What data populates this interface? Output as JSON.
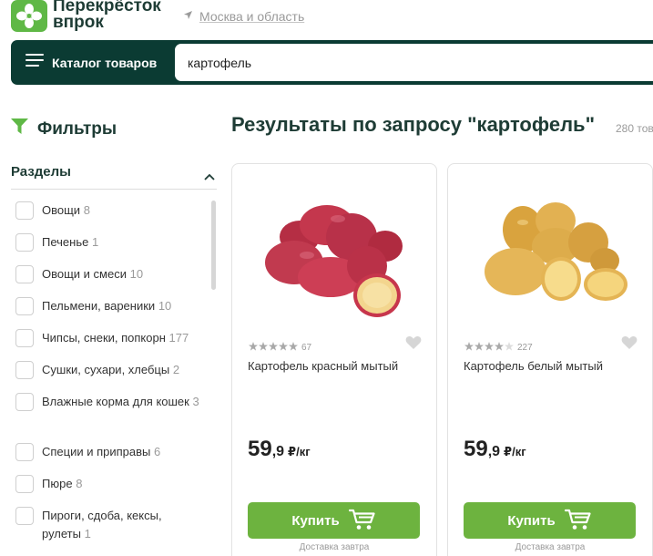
{
  "header": {
    "brand_line1": "Перекрёсток",
    "brand_line2": "впрок",
    "location": "Москва и область"
  },
  "nav": {
    "catalog_label": "Каталог товаров",
    "search_value": "картофель"
  },
  "filters": {
    "title": "Фильтры",
    "sections_title": "Разделы",
    "items": [
      {
        "label": "Овощи",
        "count": "8"
      },
      {
        "label": "Печенье",
        "count": "1"
      },
      {
        "label": "Овощи и смеси",
        "count": "10"
      },
      {
        "label": "Пельмени, вареники",
        "count": "10"
      },
      {
        "label": "Чипсы, снеки, попкорн",
        "count": "177"
      },
      {
        "label": "Сушки, сухари, хлебцы",
        "count": "2"
      },
      {
        "label": "Влажные корма для кошек",
        "count": "3"
      },
      {
        "label": "Специи и приправы",
        "count": "6"
      },
      {
        "label": "Пюре",
        "count": "8"
      },
      {
        "label": "Пироги, сдоба, кексы, рулеты",
        "count": "1"
      }
    ]
  },
  "results": {
    "title": "Результаты по запросу \"картофель\"",
    "count": "280 тов"
  },
  "products": [
    {
      "name": "Картофель красный мытый",
      "rating_count": "67",
      "rating": 5,
      "price_int": "59",
      "price_frac": ",9",
      "price_unit": "₽/кг",
      "buy_label": "Купить",
      "delivery": "Доставка завтра"
    },
    {
      "name": "Картофель белый мытый",
      "rating_count": "227",
      "rating": 4,
      "price_int": "59",
      "price_frac": ",9",
      "price_unit": "₽/кг",
      "buy_label": "Купить",
      "delivery": "Доставка завтра"
    }
  ],
  "colors": {
    "brand_dark": "#0b3b33",
    "brand_green": "#5fb846",
    "buy_green": "#6db33f",
    "potato_red": "#c4374d",
    "potato_yellow": "#e2b152"
  }
}
